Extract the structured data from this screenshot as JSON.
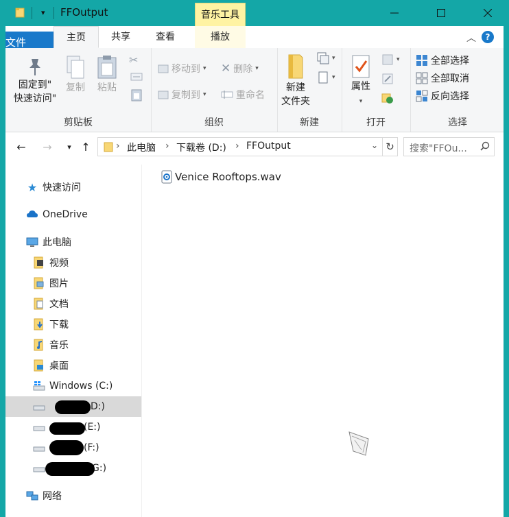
{
  "title": "FFOutput",
  "context_tab": "音乐工具",
  "tabs": [
    "文件",
    "主页",
    "共享",
    "查看",
    "播放"
  ],
  "ribbon": {
    "clipboard": {
      "pin": "固定到\"快速访问\"",
      "pin_line1": "固定到\"",
      "pin_line2": "快速访问\"",
      "copy": "复制",
      "paste": "粘贴",
      "label": "剪贴板"
    },
    "organize": {
      "move_to": "移动到",
      "copy_to": "复制到",
      "delete": "删除",
      "rename": "重命名",
      "label": "组织"
    },
    "new": {
      "new_folder_line1": "新建",
      "new_folder_line2": "文件夹",
      "label": "新建"
    },
    "open": {
      "properties": "属性",
      "label": "打开"
    },
    "select": {
      "select_all": "全部选择",
      "select_none": "全部取消",
      "invert": "反向选择",
      "label": "选择"
    }
  },
  "address": {
    "crumbs": [
      "此电脑",
      "下载卷 (D:)",
      "FFOutput"
    ]
  },
  "search": {
    "placeholder": "搜索\"FFOu..."
  },
  "nav": {
    "quick_access": "快速访问",
    "onedrive": "OneDrive",
    "this_pc": "此电脑",
    "videos": "视频",
    "pictures": "图片",
    "documents": "文档",
    "downloads": "下载",
    "music": "音乐",
    "desktop": "桌面",
    "drive_c": "Windows (C:)",
    "drive_d": "D:)",
    "drive_e": "(E:)",
    "drive_f": "(F:)",
    "drive_g": "G:)",
    "network": "网络"
  },
  "files": [
    {
      "name": "Venice Rooftops.wav",
      "icon": "audio-file-icon"
    }
  ],
  "colors": {
    "titlebar": "#14a7a7",
    "file_tab": "#1979ca",
    "context_tab": "#fff3a3",
    "selection": "#d9d9d9"
  }
}
